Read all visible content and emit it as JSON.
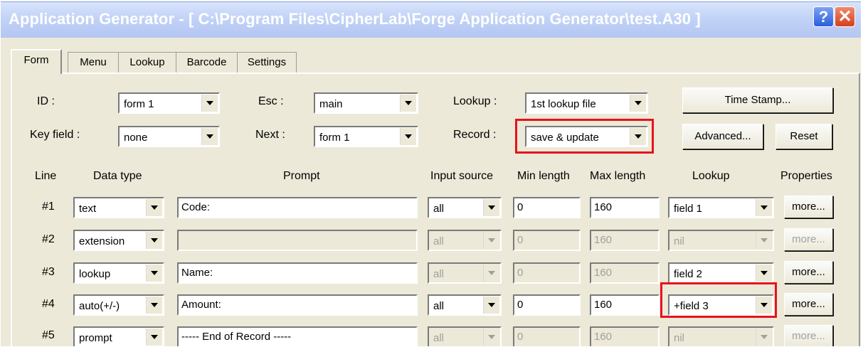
{
  "window": {
    "title": "Application Generator - [ C:\\Program Files\\CipherLab\\Forge Application Generator\\test.A30 ]",
    "help_glyph": "?",
    "close_glyph": "✕"
  },
  "tabs": [
    {
      "label": "Form",
      "active": true
    },
    {
      "label": "Menu"
    },
    {
      "label": "Lookup"
    },
    {
      "label": "Barcode"
    },
    {
      "label": "Settings"
    }
  ],
  "form": {
    "id_label": "ID :",
    "id_value": "form 1",
    "keyfield_label": "Key field :",
    "keyfield_value": "none",
    "esc_label": "Esc :",
    "esc_value": "main",
    "next_label": "Next :",
    "next_value": "form 1",
    "lookup_label": "Lookup :",
    "lookup_value": "1st lookup file",
    "record_label": "Record :",
    "record_value": "save & update",
    "timestamp_button": "Time Stamp...",
    "advanced_button": "Advanced...",
    "reset_button": "Reset"
  },
  "columns": {
    "line": "Line",
    "data_type": "Data type",
    "prompt": "Prompt",
    "input_source": "Input source",
    "min_length": "Min length",
    "max_length": "Max length",
    "lookup": "Lookup",
    "properties": "Properties"
  },
  "rows": [
    {
      "line": "#1",
      "data_type": "text",
      "prompt": "Code:",
      "input_source": "all",
      "min": "0",
      "max": "160",
      "lookup": "field 1",
      "more": "more...",
      "enabled": true
    },
    {
      "line": "#2",
      "data_type": "extension",
      "prompt": "",
      "input_source": "all",
      "min": "0",
      "max": "160",
      "lookup": "nil",
      "more": "more...",
      "enabled": false
    },
    {
      "line": "#3",
      "data_type": "lookup",
      "prompt": "Name:",
      "input_source": "all",
      "min": "0",
      "max": "160",
      "lookup": "field 2",
      "more": "more...",
      "enabled": "partial"
    },
    {
      "line": "#4",
      "data_type": "auto(+/-)",
      "prompt": "Amount:",
      "input_source": "all",
      "min": "0",
      "max": "160",
      "lookup": "+field 3",
      "more": "more...",
      "enabled": true
    },
    {
      "line": "#5",
      "data_type": "prompt",
      "prompt": "----- End of Record -----",
      "input_source": "all",
      "min": "0",
      "max": "160",
      "lookup": "nil",
      "more": "more...",
      "enabled": false
    }
  ],
  "highlight_color": "#e8121b"
}
